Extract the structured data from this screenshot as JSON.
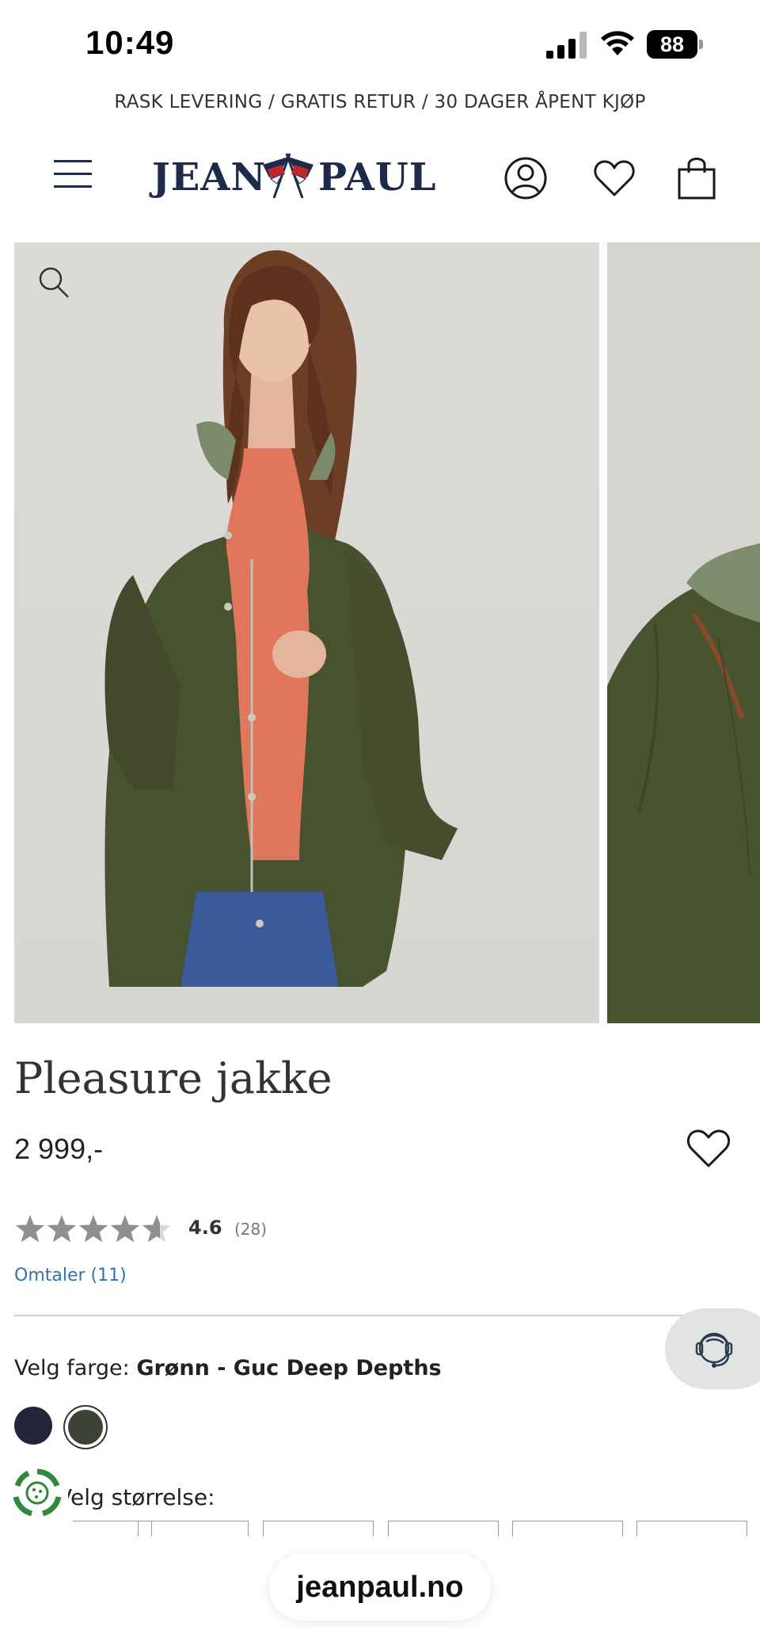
{
  "status_bar": {
    "time": "10:49",
    "battery": "88"
  },
  "promo": {
    "text": "RASK LEVERING / GRATIS RETUR / 30 DAGER ÅPENT KJØP"
  },
  "header": {
    "logo_left": "JEAN",
    "logo_right": "PAUL",
    "icons": [
      "menu-icon",
      "account-icon",
      "wishlist-icon",
      "shopping-bag-icon"
    ]
  },
  "gallery": {
    "icons": [
      "zoom-icon"
    ]
  },
  "product": {
    "title": "Pleasure jakke",
    "price": "2 999,-",
    "rating_value": "4.6",
    "rating_count": "(28)",
    "rating_stars": 4.6,
    "reviews_link": "Omtaler (11)"
  },
  "color": {
    "label_prefix": "Velg farge: ",
    "selected": "Grønn - Guc Deep Depths",
    "swatches": [
      {
        "color": "#222638"
      },
      {
        "color": "#3c4334",
        "selected": true
      }
    ]
  },
  "size": {
    "label": "Velg størrelse:"
  },
  "browser": {
    "url": "jeanpaul.no"
  },
  "colors": {
    "navy": "#1e2a4a",
    "link": "#2f73b0",
    "flag_red": "#c0272d"
  }
}
